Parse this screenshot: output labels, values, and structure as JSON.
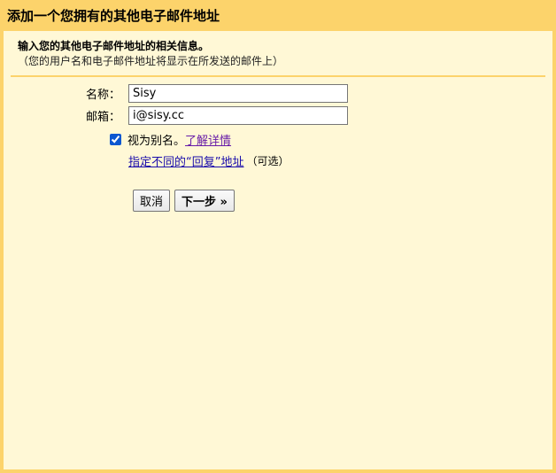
{
  "dialog": {
    "title": "添加一个您拥有的其他电子邮件地址"
  },
  "intro": {
    "heading": "输入您的其他电子邮件地址的相关信息。",
    "note": "（您的用户名和电子邮件地址将显示在所发送的邮件上）"
  },
  "form": {
    "name_label": "名称：",
    "name_value": "Sisy",
    "email_label": "邮箱：",
    "email_value": "i@sisy.cc",
    "alias_checkbox_label": "视为别名。",
    "alias_checked": true,
    "learn_more_link": "了解详情",
    "reply_to_link": "指定不同的“回复”地址",
    "reply_to_optional": "（可选）"
  },
  "buttons": {
    "cancel": "取消",
    "next": "下一步 »"
  },
  "colors": {
    "frame": "#fcd36b",
    "content_bg": "#fff8d6",
    "link": "#1a0dab",
    "visited_link": "#681da8"
  }
}
